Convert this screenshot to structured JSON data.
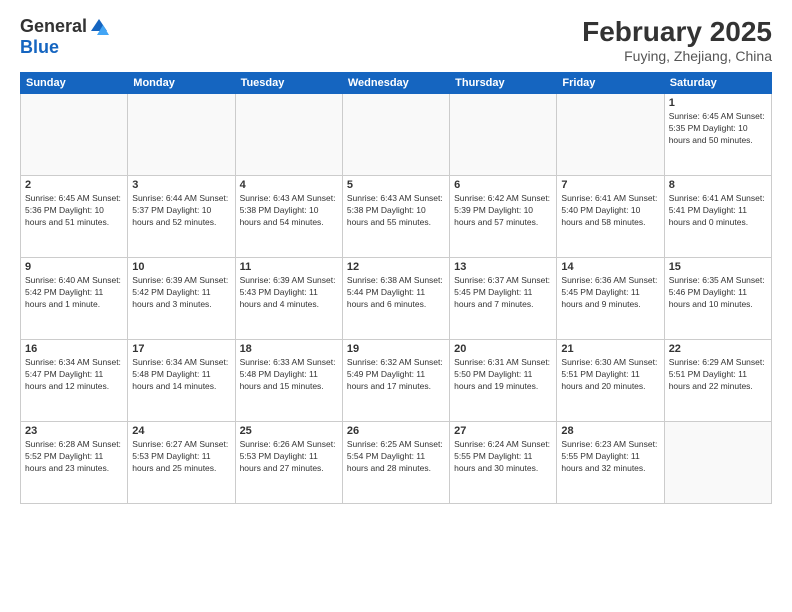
{
  "header": {
    "logo_general": "General",
    "logo_blue": "Blue",
    "month_year": "February 2025",
    "location": "Fuying, Zhejiang, China"
  },
  "days_of_week": [
    "Sunday",
    "Monday",
    "Tuesday",
    "Wednesday",
    "Thursday",
    "Friday",
    "Saturday"
  ],
  "weeks": [
    [
      {
        "day": "",
        "info": ""
      },
      {
        "day": "",
        "info": ""
      },
      {
        "day": "",
        "info": ""
      },
      {
        "day": "",
        "info": ""
      },
      {
        "day": "",
        "info": ""
      },
      {
        "day": "",
        "info": ""
      },
      {
        "day": "1",
        "info": "Sunrise: 6:45 AM\nSunset: 5:35 PM\nDaylight: 10 hours\nand 50 minutes."
      }
    ],
    [
      {
        "day": "2",
        "info": "Sunrise: 6:45 AM\nSunset: 5:36 PM\nDaylight: 10 hours\nand 51 minutes."
      },
      {
        "day": "3",
        "info": "Sunrise: 6:44 AM\nSunset: 5:37 PM\nDaylight: 10 hours\nand 52 minutes."
      },
      {
        "day": "4",
        "info": "Sunrise: 6:43 AM\nSunset: 5:38 PM\nDaylight: 10 hours\nand 54 minutes."
      },
      {
        "day": "5",
        "info": "Sunrise: 6:43 AM\nSunset: 5:38 PM\nDaylight: 10 hours\nand 55 minutes."
      },
      {
        "day": "6",
        "info": "Sunrise: 6:42 AM\nSunset: 5:39 PM\nDaylight: 10 hours\nand 57 minutes."
      },
      {
        "day": "7",
        "info": "Sunrise: 6:41 AM\nSunset: 5:40 PM\nDaylight: 10 hours\nand 58 minutes."
      },
      {
        "day": "8",
        "info": "Sunrise: 6:41 AM\nSunset: 5:41 PM\nDaylight: 11 hours\nand 0 minutes."
      }
    ],
    [
      {
        "day": "9",
        "info": "Sunrise: 6:40 AM\nSunset: 5:42 PM\nDaylight: 11 hours\nand 1 minute."
      },
      {
        "day": "10",
        "info": "Sunrise: 6:39 AM\nSunset: 5:42 PM\nDaylight: 11 hours\nand 3 minutes."
      },
      {
        "day": "11",
        "info": "Sunrise: 6:39 AM\nSunset: 5:43 PM\nDaylight: 11 hours\nand 4 minutes."
      },
      {
        "day": "12",
        "info": "Sunrise: 6:38 AM\nSunset: 5:44 PM\nDaylight: 11 hours\nand 6 minutes."
      },
      {
        "day": "13",
        "info": "Sunrise: 6:37 AM\nSunset: 5:45 PM\nDaylight: 11 hours\nand 7 minutes."
      },
      {
        "day": "14",
        "info": "Sunrise: 6:36 AM\nSunset: 5:45 PM\nDaylight: 11 hours\nand 9 minutes."
      },
      {
        "day": "15",
        "info": "Sunrise: 6:35 AM\nSunset: 5:46 PM\nDaylight: 11 hours\nand 10 minutes."
      }
    ],
    [
      {
        "day": "16",
        "info": "Sunrise: 6:34 AM\nSunset: 5:47 PM\nDaylight: 11 hours\nand 12 minutes."
      },
      {
        "day": "17",
        "info": "Sunrise: 6:34 AM\nSunset: 5:48 PM\nDaylight: 11 hours\nand 14 minutes."
      },
      {
        "day": "18",
        "info": "Sunrise: 6:33 AM\nSunset: 5:48 PM\nDaylight: 11 hours\nand 15 minutes."
      },
      {
        "day": "19",
        "info": "Sunrise: 6:32 AM\nSunset: 5:49 PM\nDaylight: 11 hours\nand 17 minutes."
      },
      {
        "day": "20",
        "info": "Sunrise: 6:31 AM\nSunset: 5:50 PM\nDaylight: 11 hours\nand 19 minutes."
      },
      {
        "day": "21",
        "info": "Sunrise: 6:30 AM\nSunset: 5:51 PM\nDaylight: 11 hours\nand 20 minutes."
      },
      {
        "day": "22",
        "info": "Sunrise: 6:29 AM\nSunset: 5:51 PM\nDaylight: 11 hours\nand 22 minutes."
      }
    ],
    [
      {
        "day": "23",
        "info": "Sunrise: 6:28 AM\nSunset: 5:52 PM\nDaylight: 11 hours\nand 23 minutes."
      },
      {
        "day": "24",
        "info": "Sunrise: 6:27 AM\nSunset: 5:53 PM\nDaylight: 11 hours\nand 25 minutes."
      },
      {
        "day": "25",
        "info": "Sunrise: 6:26 AM\nSunset: 5:53 PM\nDaylight: 11 hours\nand 27 minutes."
      },
      {
        "day": "26",
        "info": "Sunrise: 6:25 AM\nSunset: 5:54 PM\nDaylight: 11 hours\nand 28 minutes."
      },
      {
        "day": "27",
        "info": "Sunrise: 6:24 AM\nSunset: 5:55 PM\nDaylight: 11 hours\nand 30 minutes."
      },
      {
        "day": "28",
        "info": "Sunrise: 6:23 AM\nSunset: 5:55 PM\nDaylight: 11 hours\nand 32 minutes."
      },
      {
        "day": "",
        "info": ""
      }
    ]
  ]
}
